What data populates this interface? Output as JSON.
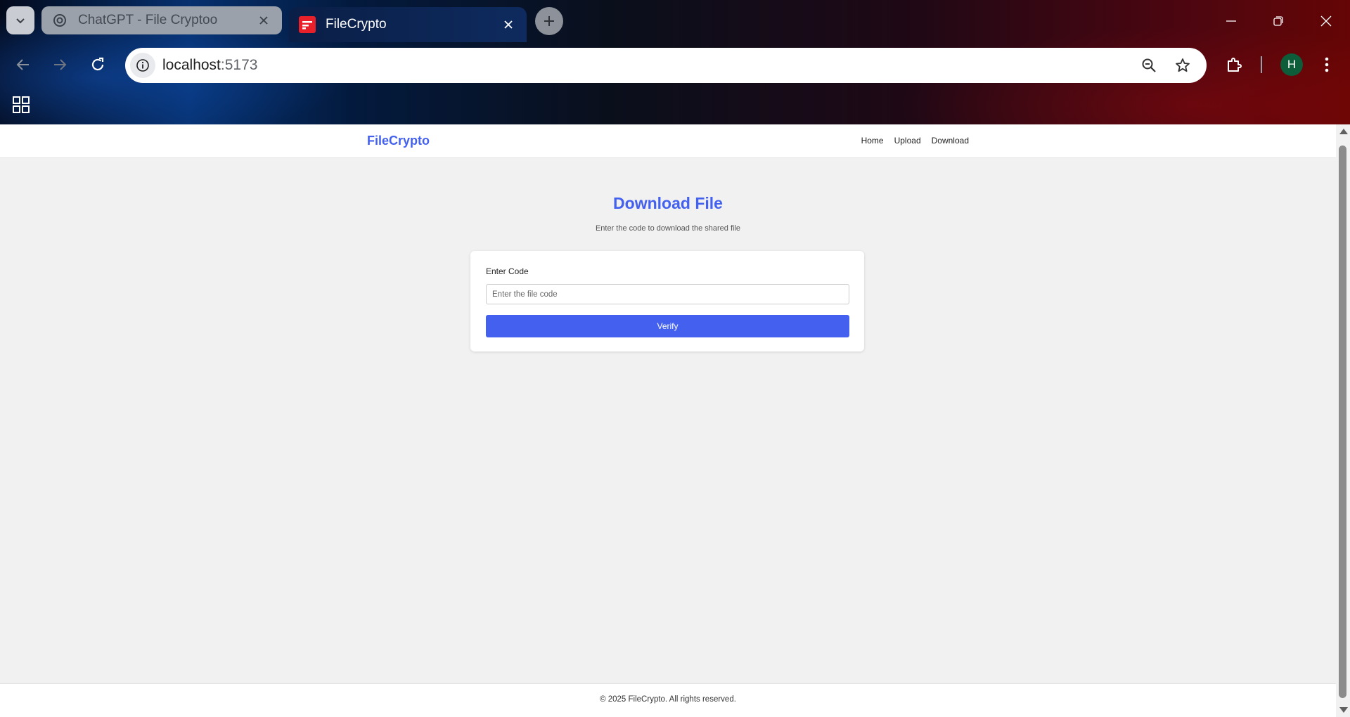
{
  "browser": {
    "tabs": [
      {
        "title": "ChatGPT - File Cryptoo",
        "icon": "chatgpt-icon",
        "active": false
      },
      {
        "title": "FileCrypto",
        "icon": "filecrypto-favicon",
        "active": true
      }
    ],
    "address_bar": {
      "host": "localhost",
      "port": ":5173"
    },
    "profile_initial": "H"
  },
  "site": {
    "brand": "FileCrypto",
    "nav": {
      "home": "Home",
      "upload": "Upload",
      "download": "Download"
    },
    "accent_color": "#4361ee"
  },
  "main": {
    "title": "Download File",
    "subtitle": "Enter the code to download the shared file",
    "form": {
      "code_label": "Enter Code",
      "code_placeholder": "Enter the file code",
      "code_value": "",
      "verify_label": "Verify"
    }
  },
  "footer": {
    "text": "© 2025 FileCrypto. All rights reserved."
  }
}
